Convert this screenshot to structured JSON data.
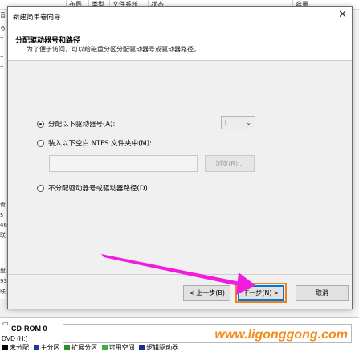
{
  "background": {
    "columns": [
      "布局",
      "类型",
      "文件系统",
      "状态",
      "容量"
    ],
    "left_fragments": [
      "音",
      "ら",
      "‒",
      "‒",
      "‒",
      "‒",
      "盘",
      "5",
      "46",
      "联",
      "盘",
      "93",
      "联"
    ],
    "disk_label": "CD-ROM 0",
    "disk_sub": "DVD (H:)",
    "legend": [
      {
        "label": "未分配",
        "color": "#000000"
      },
      {
        "label": "主分区",
        "color": "#1f3a9e"
      },
      {
        "label": "扩展分区",
        "color": "#2e8b2e"
      },
      {
        "label": "可用空间",
        "color": "#3fae3f"
      },
      {
        "label": "逻辑驱动器",
        "color": "#1a2f8a"
      }
    ]
  },
  "dialog": {
    "title": "新建简单卷向导",
    "close_glyph": "✕",
    "heading": "分配驱动器号和路径",
    "subheading": "为了便于访问，可以给磁盘分区分配驱动器号或驱动器路径。",
    "options": {
      "assign_letter": "分配以下驱动器号(A):",
      "mount_folder": "装入以下空白 NTFS 文件夹中(M):",
      "no_assign": "不分配驱动器号或驱动器路径(D)"
    },
    "selected_option": "assign_letter",
    "drive_letter": "I",
    "folder_path": "",
    "browse_label": "浏览(R)...",
    "buttons": {
      "back": "< 上一步(B)",
      "next": "下一步(N) >",
      "cancel": "取消"
    }
  },
  "annotation": {
    "arrow_color": "#f21be0",
    "highlight_color": "#f07f1e",
    "watermark": "www.ligonggong.com"
  }
}
